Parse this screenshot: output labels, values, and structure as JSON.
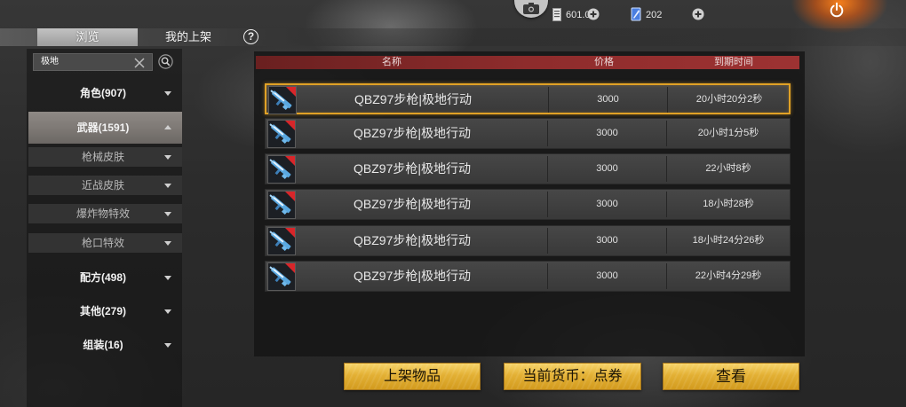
{
  "topbar": {
    "camera_icon": "camera-icon",
    "currencies": [
      {
        "icon": "ticket-icon",
        "amount": "601.01",
        "add_icon": "plus-icon"
      },
      {
        "icon": "blue-card-icon",
        "amount": "202",
        "add_icon": "plus-icon"
      }
    ],
    "power_icon": "power-icon"
  },
  "tabs": {
    "items": [
      {
        "label": "浏览",
        "selected": true
      },
      {
        "label": "我的上架",
        "selected": false
      }
    ],
    "help_glyph": "?"
  },
  "search": {
    "value": "极地",
    "clear_icon": "close-icon",
    "search_icon": "search-icon"
  },
  "categories": [
    {
      "label": "角色(907)",
      "expanded": false,
      "selected": false
    },
    {
      "label": "武器(1591)",
      "expanded": true,
      "selected": true,
      "subcategories": [
        {
          "label": "枪械皮肤"
        },
        {
          "label": "近战皮肤"
        },
        {
          "label": "爆炸物特效"
        },
        {
          "label": "枪口特效"
        }
      ]
    },
    {
      "label": "配方(498)",
      "expanded": false,
      "selected": false
    },
    {
      "label": "其他(279)",
      "expanded": false,
      "selected": false
    },
    {
      "label": "组装(16)",
      "expanded": false,
      "selected": false
    }
  ],
  "listing_table": {
    "headers": {
      "item": "名称",
      "price": "价格",
      "expires": "到期时间"
    },
    "rows": [
      {
        "thumbnail_icon": "rifle-skin-icon",
        "item": "QBZ97步枪|极地行动",
        "price": "3000",
        "expires": "20小时20分2秒",
        "highlighted": true
      },
      {
        "thumbnail_icon": "rifle-skin-icon",
        "item": "QBZ97步枪|极地行动",
        "price": "3000",
        "expires": "20小时1分5秒",
        "highlighted": false
      },
      {
        "thumbnail_icon": "rifle-skin-icon",
        "item": "QBZ97步枪|极地行动",
        "price": "3000",
        "expires": "22小时8秒",
        "highlighted": false
      },
      {
        "thumbnail_icon": "rifle-skin-icon",
        "item": "QBZ97步枪|极地行动",
        "price": "3000",
        "expires": "18小时28秒",
        "highlighted": false
      },
      {
        "thumbnail_icon": "rifle-skin-icon",
        "item": "QBZ97步枪|极地行动",
        "price": "3000",
        "expires": "18小时24分26秒",
        "highlighted": false
      },
      {
        "thumbnail_icon": "rifle-skin-icon",
        "item": "QBZ97步枪|极地行动",
        "price": "3000",
        "expires": "22小时4分29秒",
        "highlighted": false
      }
    ]
  },
  "actions": {
    "list_item": "上架物品",
    "currency": "当前货币：点券",
    "view": "查看"
  },
  "colors": {
    "header_red": "#8e2c2c",
    "highlight_border": "#e0a126",
    "button_gold": "#e3b034",
    "selected_category": "#7d7874",
    "row_background": "#404040"
  }
}
